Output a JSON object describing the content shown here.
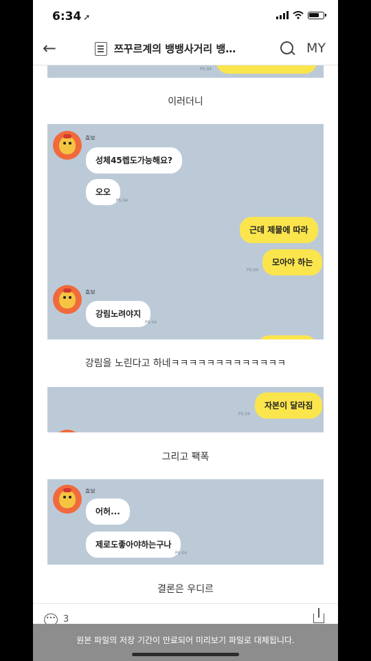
{
  "status_bar": {
    "time": "6:34",
    "location_glyph": "➚"
  },
  "header": {
    "back_glyph": "←",
    "title": "쯔꾸르계의 뱅뱅사거리 뱅…",
    "my_label": "MY"
  },
  "captions": [
    "이러더니",
    "강림을 노린다고 하네ㅋㅋㅋㅋㅋㅋㅋㅋㅋㅋㅋㅋㅋ",
    "그리고 팩폭",
    "결론은 우디르"
  ],
  "screenshots": {
    "s0": {
      "meta": "PS:04"
    },
    "s1": {
      "name_a": "효보",
      "msg_a1": "성체45렙도가능해요?",
      "msg_a2": "오오",
      "meta_a2": "PS:04",
      "msg_b1": "근데 제물에 따라",
      "msg_b2": "모아야 하는",
      "meta_b2": "PS:04",
      "name_c": "효보",
      "msg_c1": "강림노려야지",
      "meta_c1": "PS:04"
    },
    "s2": {
      "msg": "자본이 달라짐",
      "meta": "PS:04"
    },
    "s3": {
      "name": "효보",
      "msg1": "어허...",
      "msg2": "제로도좋아야하는구나",
      "meta2": "PS:04"
    }
  },
  "footer": {
    "comment_icon_glyph": "•••",
    "comment_count": "3"
  },
  "toast": {
    "message": "원본 파일의 저장 기간이 만료되어 미리보기 파일로 대체됩니다."
  },
  "colors": {
    "chat_bg": "#bccad8",
    "yellow_bubble": "#fbe54d",
    "avatar": "#f06a3c"
  }
}
